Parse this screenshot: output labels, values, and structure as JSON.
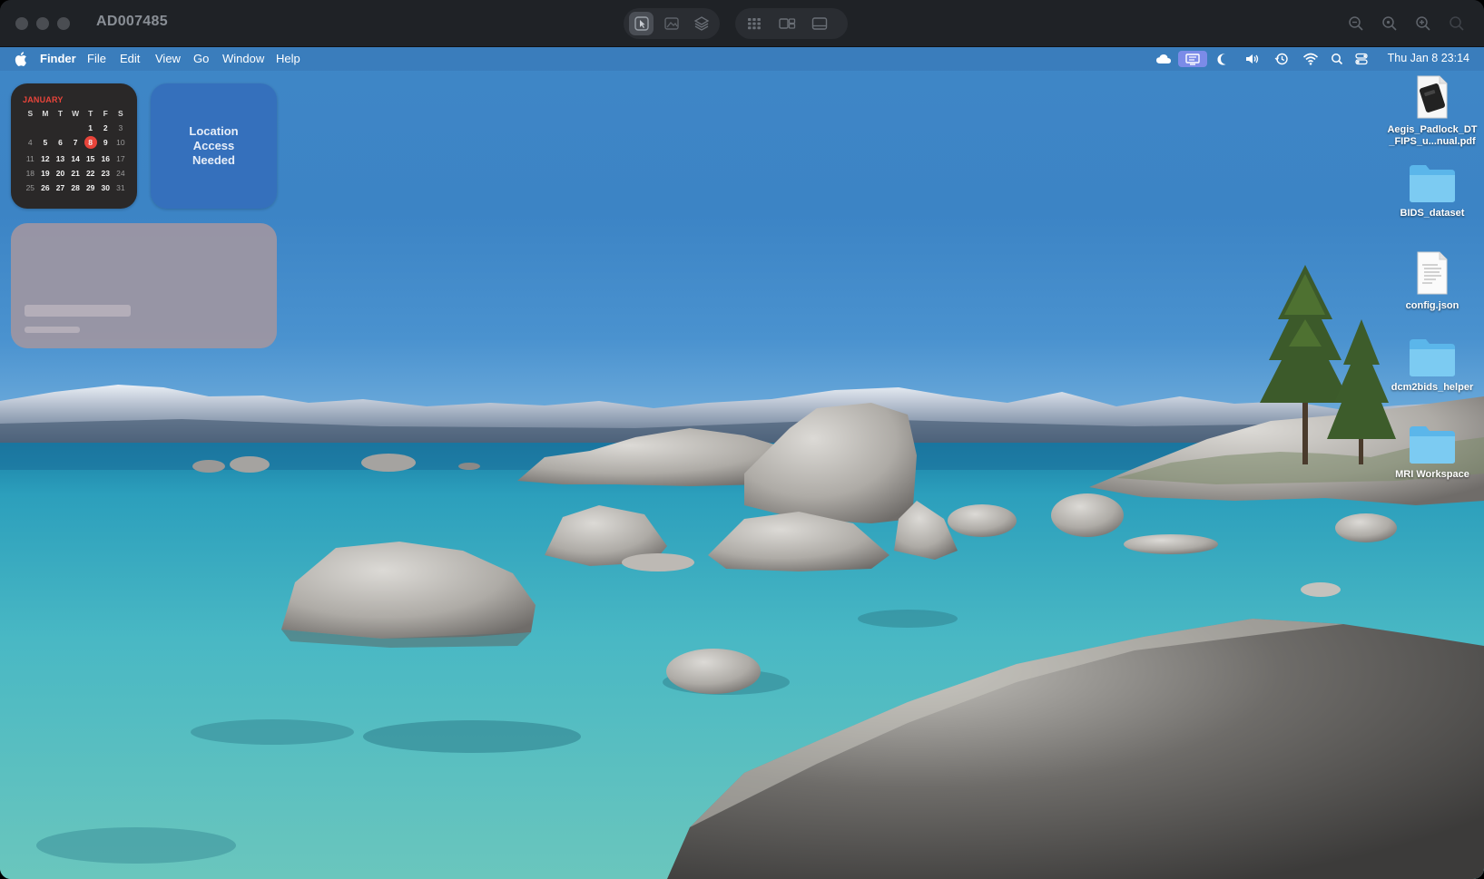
{
  "viewer": {
    "title": "AD007485"
  },
  "menubar": {
    "app_name": "Finder",
    "menus": [
      "File",
      "Edit",
      "View",
      "Go",
      "Window",
      "Help"
    ],
    "clock": "Thu Jan 8  23:14"
  },
  "calendar_widget": {
    "month": "JANUARY",
    "weekdays": [
      "S",
      "M",
      "T",
      "W",
      "T",
      "F",
      "S"
    ],
    "weeks": [
      [
        "",
        "",
        "",
        "",
        "1",
        "2",
        "3"
      ],
      [
        "4",
        "5",
        "6",
        "7",
        "8",
        "9",
        "10"
      ],
      [
        "11",
        "12",
        "13",
        "14",
        "15",
        "16",
        "17"
      ],
      [
        "18",
        "19",
        "20",
        "21",
        "22",
        "23",
        "24"
      ],
      [
        "25",
        "26",
        "27",
        "28",
        "29",
        "30",
        "31"
      ]
    ],
    "today": "8",
    "accent_color": "#e8443a"
  },
  "location_widget": {
    "text": "Location\nAccess\nNeeded"
  },
  "desktop_icons": [
    {
      "label": "Aegis_Padlock_DT\n_FIPS_u...nual.pdf",
      "icon": "pdf-document-icon"
    },
    {
      "label": "BIDS_dataset",
      "icon": "folder-icon"
    },
    {
      "label": "config.json",
      "icon": "json-document-icon"
    },
    {
      "label": "dcm2bids_helper",
      "icon": "folder-icon"
    },
    {
      "label": "MRI Workspace",
      "icon": "folder-icon"
    }
  ]
}
